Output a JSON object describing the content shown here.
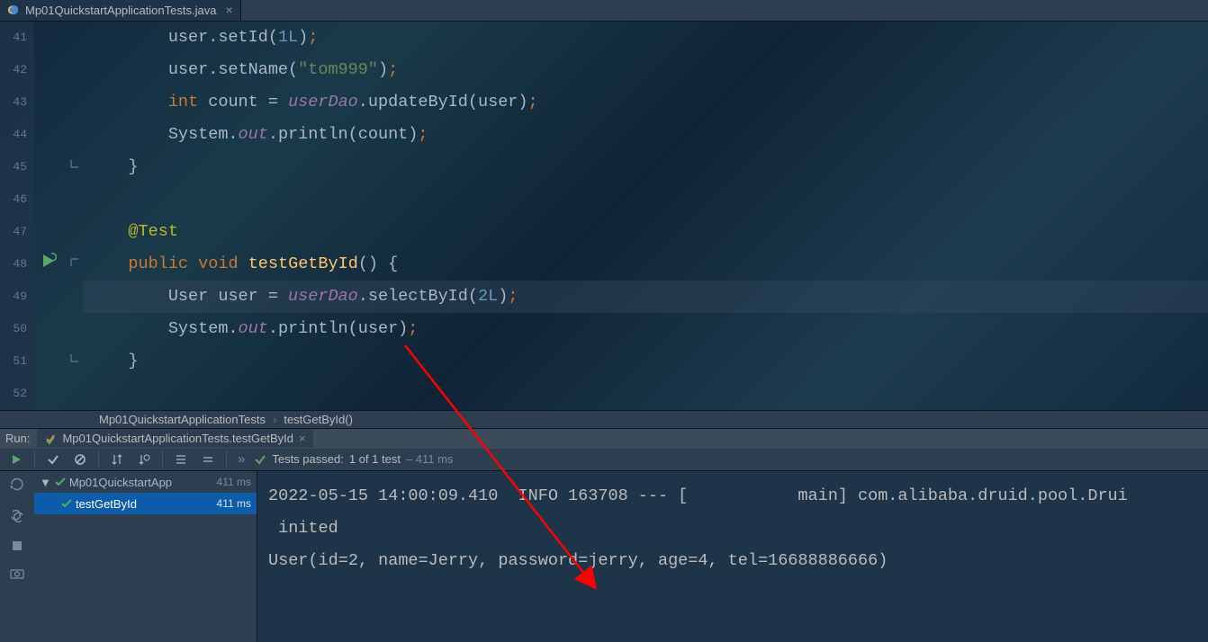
{
  "tab": {
    "filename": "Mp01QuickstartApplicationTests.java"
  },
  "gutter": {
    "start": 41,
    "end": 52
  },
  "code_lines": [
    {
      "n": 41,
      "tokens": [
        {
          "t": "        user.setId(",
          "c": "type"
        },
        {
          "t": "1L",
          "c": "num"
        },
        {
          "t": ")",
          "c": "type"
        },
        {
          "t": ";",
          "c": "semi"
        }
      ]
    },
    {
      "n": 42,
      "tokens": [
        {
          "t": "        user.setName(",
          "c": "type"
        },
        {
          "t": "\"tom999\"",
          "c": "str"
        },
        {
          "t": ")",
          "c": "type"
        },
        {
          "t": ";",
          "c": "semi"
        }
      ]
    },
    {
      "n": 43,
      "tokens": [
        {
          "t": "        ",
          "c": "type"
        },
        {
          "t": "int",
          "c": "kw"
        },
        {
          "t": " count = ",
          "c": "type"
        },
        {
          "t": "userDao",
          "c": "field"
        },
        {
          "t": ".updateById(user)",
          "c": "type"
        },
        {
          "t": ";",
          "c": "semi"
        }
      ]
    },
    {
      "n": 44,
      "tokens": [
        {
          "t": "        System.",
          "c": "type"
        },
        {
          "t": "out",
          "c": "staticfield"
        },
        {
          "t": ".println(count)",
          "c": "type"
        },
        {
          "t": ";",
          "c": "semi"
        }
      ]
    },
    {
      "n": 45,
      "tokens": [
        {
          "t": "    }",
          "c": "type"
        }
      ]
    },
    {
      "n": 46,
      "tokens": [
        {
          "t": "",
          "c": "type"
        }
      ]
    },
    {
      "n": 47,
      "tokens": [
        {
          "t": "    ",
          "c": "type"
        },
        {
          "t": "@Test",
          "c": "anno"
        }
      ]
    },
    {
      "n": 48,
      "tokens": [
        {
          "t": "    ",
          "c": "type"
        },
        {
          "t": "public",
          "c": "kw"
        },
        {
          "t": " ",
          "c": "type"
        },
        {
          "t": "void",
          "c": "kw"
        },
        {
          "t": " ",
          "c": "type"
        },
        {
          "t": "testGetById",
          "c": "method"
        },
        {
          "t": "() {",
          "c": "type"
        }
      ]
    },
    {
      "n": 49,
      "tokens": [
        {
          "t": "        User user = ",
          "c": "type"
        },
        {
          "t": "userDao",
          "c": "field"
        },
        {
          "t": ".selectById(",
          "c": "type"
        },
        {
          "t": "2L",
          "c": "num"
        },
        {
          "t": ")",
          "c": "type"
        },
        {
          "t": ";",
          "c": "semi"
        }
      ]
    },
    {
      "n": 50,
      "tokens": [
        {
          "t": "        System.",
          "c": "type"
        },
        {
          "t": "out",
          "c": "staticfield"
        },
        {
          "t": ".println(user)",
          "c": "type"
        },
        {
          "t": ";",
          "c": "semi"
        }
      ]
    },
    {
      "n": 51,
      "tokens": [
        {
          "t": "    }",
          "c": "type"
        }
      ]
    },
    {
      "n": 52,
      "tokens": [
        {
          "t": "",
          "c": "type"
        }
      ]
    }
  ],
  "highlight_line": 49,
  "breadcrumb": {
    "class": "Mp01QuickstartApplicationTests",
    "method": "testGetById()"
  },
  "run": {
    "label": "Run:",
    "tab": "Mp01QuickstartApplicationTests.testGetById",
    "status_prefix": "Tests passed:",
    "status_count": "1 of 1 test",
    "status_time": "– 411 ms"
  },
  "tree": {
    "root": {
      "label": "Mp01QuickstartApp",
      "time": "411 ms"
    },
    "leaf": {
      "label": "testGetById",
      "time": "411 ms"
    }
  },
  "console": {
    "line1": "2022-05-15 14:00:09.410  INFO 163708 --- [           main] com.alibaba.druid.pool.Drui",
    "line2": " inited",
    "line3": "User(id=2, name=Jerry, password=jerry, age=4, tel=16688886666)"
  }
}
